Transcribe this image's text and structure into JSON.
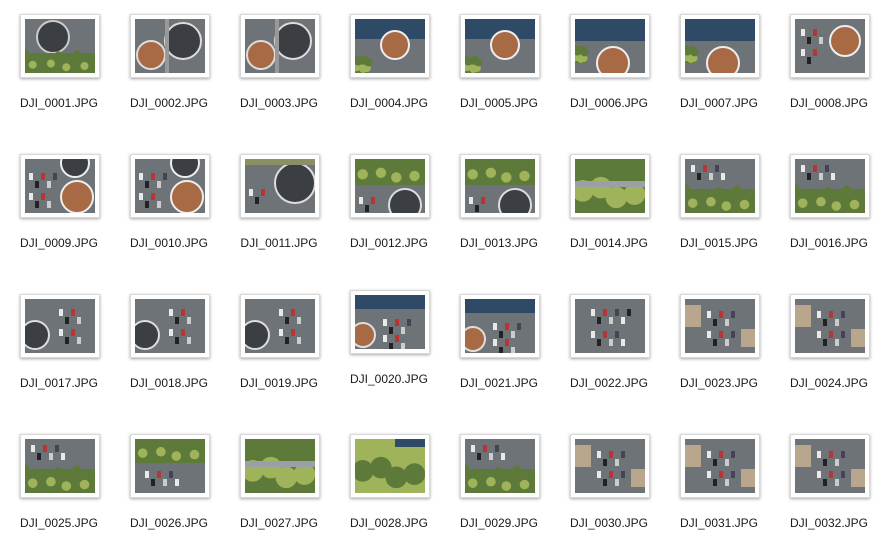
{
  "view": {
    "mode": "icon",
    "files": [
      {
        "name": "DJI_0001.JPG",
        "scene": "clarifier-trees"
      },
      {
        "name": "DJI_0002.JPG",
        "scene": "two-clarifiers"
      },
      {
        "name": "DJI_0003.JPG",
        "scene": "two-clarifiers"
      },
      {
        "name": "DJI_0004.JPG",
        "scene": "clarifier-dark"
      },
      {
        "name": "DJI_0005.JPG",
        "scene": "clarifier-dark"
      },
      {
        "name": "DJI_0006.JPG",
        "scene": "clarifier-roof"
      },
      {
        "name": "DJI_0007.JPG",
        "scene": "clarifier-roof"
      },
      {
        "name": "DJI_0008.JPG",
        "scene": "clarifier-lot"
      },
      {
        "name": "DJI_0009.JPG",
        "scene": "lot-clarifier"
      },
      {
        "name": "DJI_0010.JPG",
        "scene": "lot-clarifier"
      },
      {
        "name": "DJI_0011.JPG",
        "scene": "clarifier-gray"
      },
      {
        "name": "DJI_0012.JPG",
        "scene": "trees-clarifier"
      },
      {
        "name": "DJI_0013.JPG",
        "scene": "trees-clarifier"
      },
      {
        "name": "DJI_0014.JPG",
        "scene": "trees"
      },
      {
        "name": "DJI_0015.JPG",
        "scene": "lot-trees"
      },
      {
        "name": "DJI_0016.JPG",
        "scene": "lot-trees"
      },
      {
        "name": "DJI_0017.JPG",
        "scene": "lot-dark"
      },
      {
        "name": "DJI_0018.JPG",
        "scene": "lot-dark"
      },
      {
        "name": "DJI_0019.JPG",
        "scene": "lot-dark"
      },
      {
        "name": "DJI_0020.JPG",
        "scene": "roof-lot"
      },
      {
        "name": "DJI_0021.JPG",
        "scene": "roof-lot"
      },
      {
        "name": "DJI_0022.JPG",
        "scene": "parking"
      },
      {
        "name": "DJI_0023.JPG",
        "scene": "parking-roof"
      },
      {
        "name": "DJI_0024.JPG",
        "scene": "parking-roof"
      },
      {
        "name": "DJI_0025.JPG",
        "scene": "lot-trees"
      },
      {
        "name": "DJI_0026.JPG",
        "scene": "trees-lot"
      },
      {
        "name": "DJI_0027.JPG",
        "scene": "trees"
      },
      {
        "name": "DJI_0028.JPG",
        "scene": "trees-road"
      },
      {
        "name": "DJI_0029.JPG",
        "scene": "lot-trees"
      },
      {
        "name": "DJI_0030.JPG",
        "scene": "parking-roof"
      },
      {
        "name": "DJI_0031.JPG",
        "scene": "parking-roof"
      },
      {
        "name": "DJI_0032.JPG",
        "scene": "parking-roof"
      }
    ]
  },
  "colors": {
    "background": "#ffffff",
    "label_text": "#1a1a1a",
    "asphalt": "#6e7378",
    "tree": "#5d7a3a",
    "tree_light": "#9fb35a",
    "tank_water": "#3b3f44",
    "tank_rust": "#a86a45",
    "roof": "#2f4a66"
  }
}
